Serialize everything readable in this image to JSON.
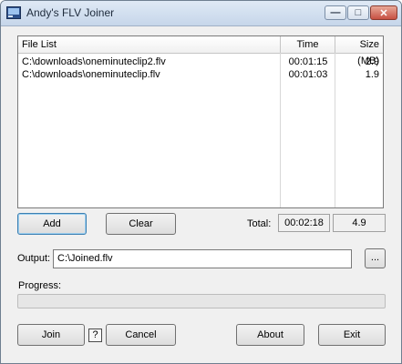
{
  "window": {
    "title": "Andy's FLV Joiner"
  },
  "titlebar_icons": {
    "minimize": "minimize-icon",
    "maximize": "maximize-icon",
    "close": "close-icon"
  },
  "file_list": {
    "columns": [
      "File List",
      "Time",
      "Size (MB)"
    ],
    "rows": [
      {
        "name": "C:\\downloads\\oneminuteclip2.flv",
        "time": "00:01:15",
        "size": "2.9"
      },
      {
        "name": "C:\\downloads\\oneminuteclip.flv",
        "time": "00:01:03",
        "size": "1.9"
      }
    ]
  },
  "buttons": {
    "add": "Add",
    "clear": "Clear",
    "browse": "...",
    "join": "Join",
    "help": "?",
    "cancel": "Cancel",
    "about": "About",
    "exit": "Exit"
  },
  "totals": {
    "label": "Total:",
    "time": "00:02:18",
    "size": "4.9"
  },
  "output": {
    "label": "Output:",
    "value": "C:\\Joined.flv"
  },
  "progress": {
    "label": "Progress:",
    "value": 0
  }
}
